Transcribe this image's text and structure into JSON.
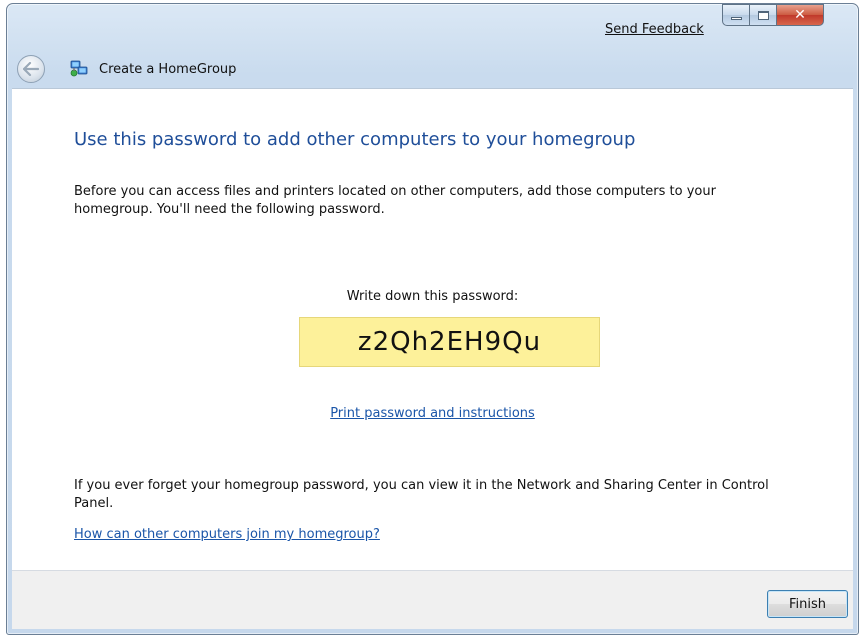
{
  "titlebar": {
    "send_feedback": "Send Feedback",
    "minimize_icon": "minimize-icon",
    "maximize_icon": "maximize-icon",
    "close_icon": "close-icon",
    "close_glyph": "✕",
    "close_color": "#c0392b"
  },
  "nav": {
    "back_icon": "back-arrow-icon",
    "homegroup_icon": "homegroup-icon",
    "title": "Create a HomeGroup"
  },
  "main": {
    "headline": "Use this password to add other computers to your homegroup",
    "intro": "Before you can access files and printers located on other computers, add those computers to your homegroup.  You'll need the following password.",
    "password_label": "Write down this password:",
    "password": "z2Qh2EH9Qu",
    "password_box_color": "#fdf19a",
    "print_link": "Print password and instructions",
    "forget_text": "If you ever forget your homegroup password, you can view it in the Network and Sharing Center in Control Panel.",
    "join_link": "How can other computers join my homegroup?",
    "link_color": "#1a55a8",
    "headline_color": "#1f4e99"
  },
  "footer": {
    "finish_label": "Finish"
  }
}
